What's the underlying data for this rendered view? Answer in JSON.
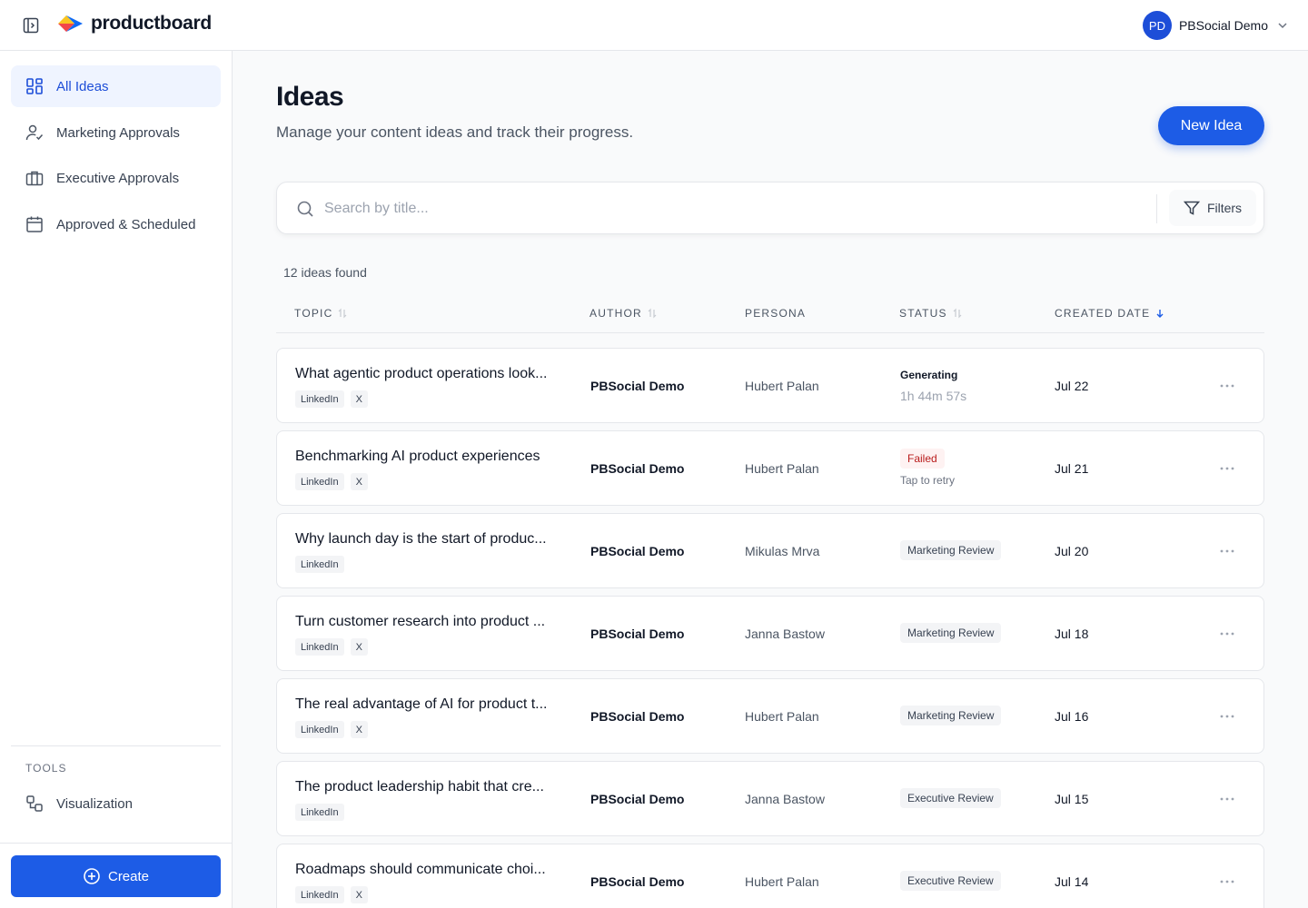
{
  "brand": {
    "name": "productboard"
  },
  "user": {
    "initials": "PD",
    "name": "PBSocial Demo"
  },
  "sidebar": {
    "items": [
      {
        "label": "All Ideas",
        "icon": "grid-icon",
        "active": true
      },
      {
        "label": "Marketing Approvals",
        "icon": "user-check-icon",
        "active": false
      },
      {
        "label": "Executive Approvals",
        "icon": "briefcase-icon",
        "active": false
      },
      {
        "label": "Approved & Scheduled",
        "icon": "calendar-icon",
        "active": false
      }
    ],
    "tools_label": "TOOLS",
    "tools": [
      {
        "label": "Visualization",
        "icon": "visualization-icon"
      }
    ],
    "create_label": "Create"
  },
  "page": {
    "title": "Ideas",
    "subtitle": "Manage your content ideas and track their progress.",
    "new_idea_label": "New Idea"
  },
  "search": {
    "placeholder": "Search by title...",
    "filters_label": "Filters"
  },
  "results": {
    "count_text": "12 ideas found"
  },
  "table": {
    "columns": [
      {
        "label": "TOPIC",
        "sort": "none"
      },
      {
        "label": "AUTHOR",
        "sort": "none"
      },
      {
        "label": "PERSONA",
        "sort": "unsortable"
      },
      {
        "label": "STATUS",
        "sort": "none"
      },
      {
        "label": "CREATED DATE",
        "sort": "desc"
      }
    ],
    "rows": [
      {
        "topic": "What agentic product operations look...",
        "tags": [
          "LinkedIn",
          "X"
        ],
        "author": "PBSocial Demo",
        "persona": "Hubert Palan",
        "status": {
          "type": "generating",
          "label": "Generating",
          "sub": "1h 44m 57s"
        },
        "created": "Jul 22"
      },
      {
        "topic": "Benchmarking AI product experiences",
        "tags": [
          "LinkedIn",
          "X"
        ],
        "author": "PBSocial Demo",
        "persona": "Hubert Palan",
        "status": {
          "type": "failed",
          "label": "Failed",
          "sub": "Tap to retry"
        },
        "created": "Jul 21"
      },
      {
        "topic": "Why launch day is the start of produc...",
        "tags": [
          "LinkedIn"
        ],
        "author": "PBSocial Demo",
        "persona": "Mikulas Mrva",
        "status": {
          "type": "badge",
          "label": "Marketing Review"
        },
        "created": "Jul 20"
      },
      {
        "topic": "Turn customer research into product ...",
        "tags": [
          "LinkedIn",
          "X"
        ],
        "author": "PBSocial Demo",
        "persona": "Janna Bastow",
        "status": {
          "type": "badge",
          "label": "Marketing Review"
        },
        "created": "Jul 18"
      },
      {
        "topic": "The real advantage of AI for product t...",
        "tags": [
          "LinkedIn",
          "X"
        ],
        "author": "PBSocial Demo",
        "persona": "Hubert Palan",
        "status": {
          "type": "badge",
          "label": "Marketing Review"
        },
        "created": "Jul 16"
      },
      {
        "topic": "The product leadership habit that cre...",
        "tags": [
          "LinkedIn"
        ],
        "author": "PBSocial Demo",
        "persona": "Janna Bastow",
        "status": {
          "type": "badge",
          "label": "Executive Review"
        },
        "created": "Jul 15"
      },
      {
        "topic": "Roadmaps should communicate choi...",
        "tags": [
          "LinkedIn",
          "X"
        ],
        "author": "PBSocial Demo",
        "persona": "Hubert Palan",
        "status": {
          "type": "badge",
          "label": "Executive Review"
        },
        "created": "Jul 14"
      }
    ]
  },
  "colors": {
    "accent": "#1d5ce6",
    "active_bg": "#eff4ff",
    "failed": "#b91c1c"
  }
}
